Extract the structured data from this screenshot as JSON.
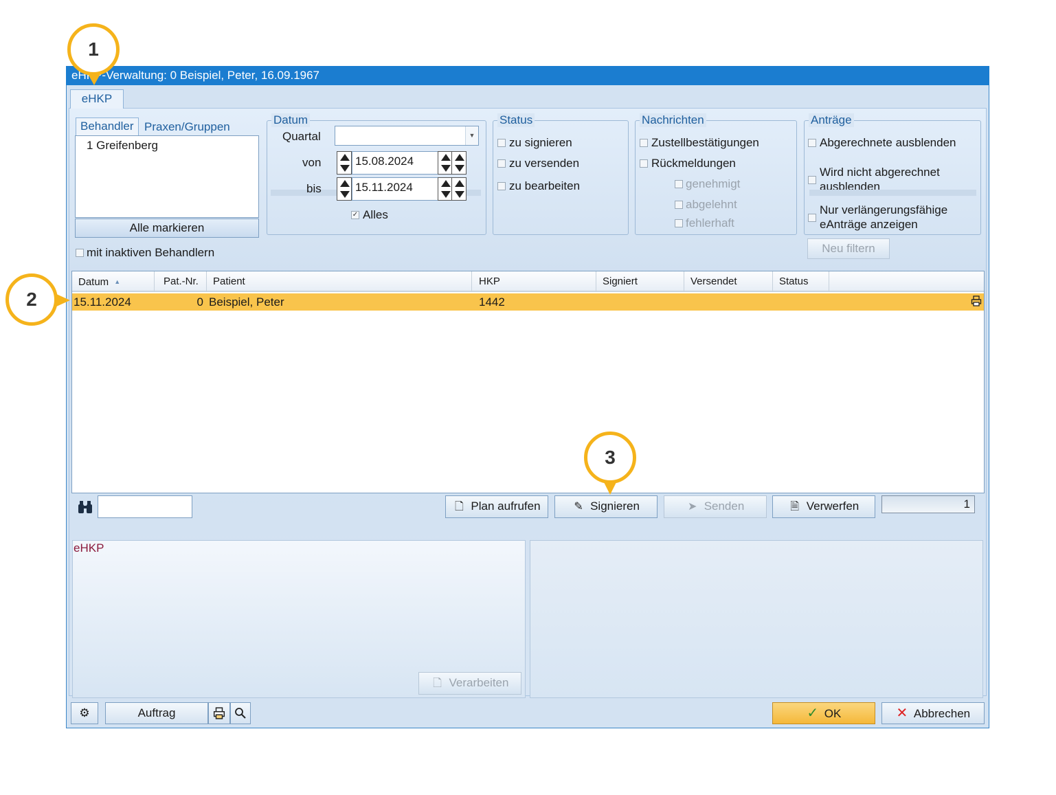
{
  "window": {
    "title": "eHKP-Verwaltung: 0 Beispiel, Peter, 16.09.1967",
    "help": "?",
    "close": "✕",
    "tab": "eHKP"
  },
  "behandler": {
    "tabs": [
      "Behandler",
      "Praxen/Gruppen"
    ],
    "items": [
      "1 Greifenberg"
    ],
    "select_all": "Alle markieren",
    "inactive_label": "mit inaktiven Behandlern"
  },
  "datum": {
    "title": "Datum",
    "quartal_label": "Quartal",
    "quartal_value": "",
    "von_label": "von",
    "von_value": "15.08.2024",
    "bis_label": "bis",
    "bis_value": "15.11.2024",
    "alles_label": "Alles",
    "alles_checked": "✓"
  },
  "status": {
    "title": "Status",
    "items": [
      "zu signieren",
      "zu versenden",
      "zu bearbeiten"
    ]
  },
  "nachrichten": {
    "title": "Nachrichten",
    "items": [
      "Zustellbestätigungen",
      "Rückmeldungen"
    ],
    "sub_items": [
      "genehmigt",
      "abgelehnt",
      "fehlerhaft"
    ]
  },
  "antraege": {
    "title": "Anträge",
    "item1": "Abgerechnete ausblenden",
    "item2_line1": "Wird nicht abgerechnet",
    "item2_line2": "ausblenden",
    "item3_line1": "Nur verlängerungsfähige",
    "item3_line2": "eAnträge anzeigen",
    "filter_button": "Neu filtern"
  },
  "table": {
    "columns": [
      "Datum",
      "Pat.-Nr.",
      "Patient",
      "HKP",
      "Signiert",
      "Versendet",
      "Status"
    ],
    "sort_indicator": "▲",
    "rows": [
      {
        "datum": "15.11.2024",
        "patnr": "0",
        "patient": "Beispiel, Peter",
        "hkp": "1442",
        "signiert": "",
        "versendet": "",
        "status": ""
      }
    ]
  },
  "actions": {
    "search_value": "",
    "plan": "Plan aufrufen",
    "signieren": "Signieren",
    "senden": "Senden",
    "verwerfen": "Verwerfen",
    "count": "1"
  },
  "detail": {
    "left_title": "eHKP",
    "verarbeiten": "Verarbeiten"
  },
  "footer": {
    "auftrag": "Auftrag",
    "ok": "OK",
    "abbrechen": "Abbrechen"
  },
  "callouts": [
    "1",
    "2",
    "3"
  ],
  "colors": {
    "titlebar": "#1b7dd0",
    "selected_row": "#f9c44c",
    "callout_ring": "#f5b31b",
    "ok_button": "#f8c150"
  }
}
